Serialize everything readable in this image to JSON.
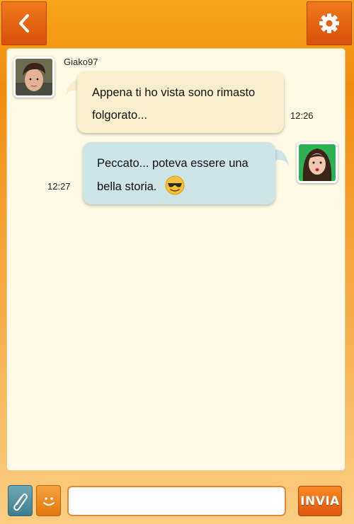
{
  "header": {
    "back_icon": "chevron-left-icon",
    "settings_icon": "gear-icon"
  },
  "conversation": {
    "messages": [
      {
        "sender": "Giako97",
        "text": "Appena ti ho vista sono rimasto folgorato...",
        "time": "12:26",
        "side": "left",
        "bubble_color": "#f9efcd"
      },
      {
        "sender": "",
        "text": "Peccato... poteva essere una bella storia.",
        "time": "12:27",
        "side": "right",
        "bubble_color": "#cde5e6",
        "emoji": "sunglasses-smiley"
      }
    ]
  },
  "composer": {
    "attach_icon": "paperclip-icon",
    "emoji_icon": "smiley-icon",
    "input_value": "",
    "send_label": "INVIA"
  },
  "colors": {
    "accent": "#f28c10",
    "panel": "#fefae6"
  }
}
